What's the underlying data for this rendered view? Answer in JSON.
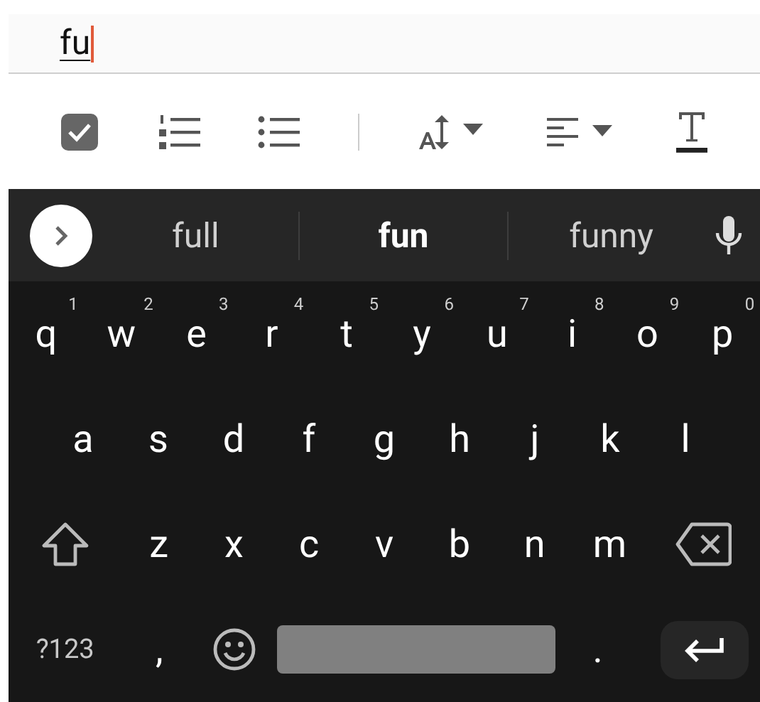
{
  "editor": {
    "value": "fu",
    "composing": true
  },
  "toolbar": [
    {
      "kind": "checkbox"
    },
    {
      "kind": "numbered-list"
    },
    {
      "kind": "bulleted-list"
    },
    {
      "kind": "divider"
    },
    {
      "kind": "text-size"
    },
    {
      "kind": "align"
    },
    {
      "kind": "text-style"
    }
  ],
  "suggestions": [
    {
      "text": "full",
      "selected": false
    },
    {
      "text": "fun",
      "selected": true
    },
    {
      "text": "funny",
      "selected": false
    }
  ],
  "keyboard": {
    "rows": [
      {
        "keys": [
          {
            "kind": "char",
            "label": "q",
            "hint": "1"
          },
          {
            "kind": "char",
            "label": "w",
            "hint": "2"
          },
          {
            "kind": "char",
            "label": "e",
            "hint": "3"
          },
          {
            "kind": "char",
            "label": "r",
            "hint": "4"
          },
          {
            "kind": "char",
            "label": "t",
            "hint": "5"
          },
          {
            "kind": "char",
            "label": "y",
            "hint": "6"
          },
          {
            "kind": "char",
            "label": "u",
            "hint": "7"
          },
          {
            "kind": "char",
            "label": "i",
            "hint": "8"
          },
          {
            "kind": "char",
            "label": "o",
            "hint": "9"
          },
          {
            "kind": "char",
            "label": "p",
            "hint": "0"
          }
        ]
      },
      {
        "keys": [
          {
            "kind": "char",
            "label": "a"
          },
          {
            "kind": "char",
            "label": "s"
          },
          {
            "kind": "char",
            "label": "d"
          },
          {
            "kind": "char",
            "label": "f"
          },
          {
            "kind": "char",
            "label": "g"
          },
          {
            "kind": "char",
            "label": "h"
          },
          {
            "kind": "char",
            "label": "j"
          },
          {
            "kind": "char",
            "label": "k"
          },
          {
            "kind": "char",
            "label": "l"
          }
        ]
      },
      {
        "keys": [
          {
            "kind": "shift"
          },
          {
            "kind": "char",
            "label": "z"
          },
          {
            "kind": "char",
            "label": "x"
          },
          {
            "kind": "char",
            "label": "c"
          },
          {
            "kind": "char",
            "label": "v"
          },
          {
            "kind": "char",
            "label": "b"
          },
          {
            "kind": "char",
            "label": "n"
          },
          {
            "kind": "char",
            "label": "m"
          },
          {
            "kind": "backspace"
          }
        ]
      },
      {
        "keys": [
          {
            "kind": "symbols",
            "label": "?123"
          },
          {
            "kind": "char",
            "label": ","
          },
          {
            "kind": "emoji"
          },
          {
            "kind": "space"
          },
          {
            "kind": "char",
            "label": "."
          },
          {
            "kind": "enter"
          }
        ]
      }
    ]
  }
}
